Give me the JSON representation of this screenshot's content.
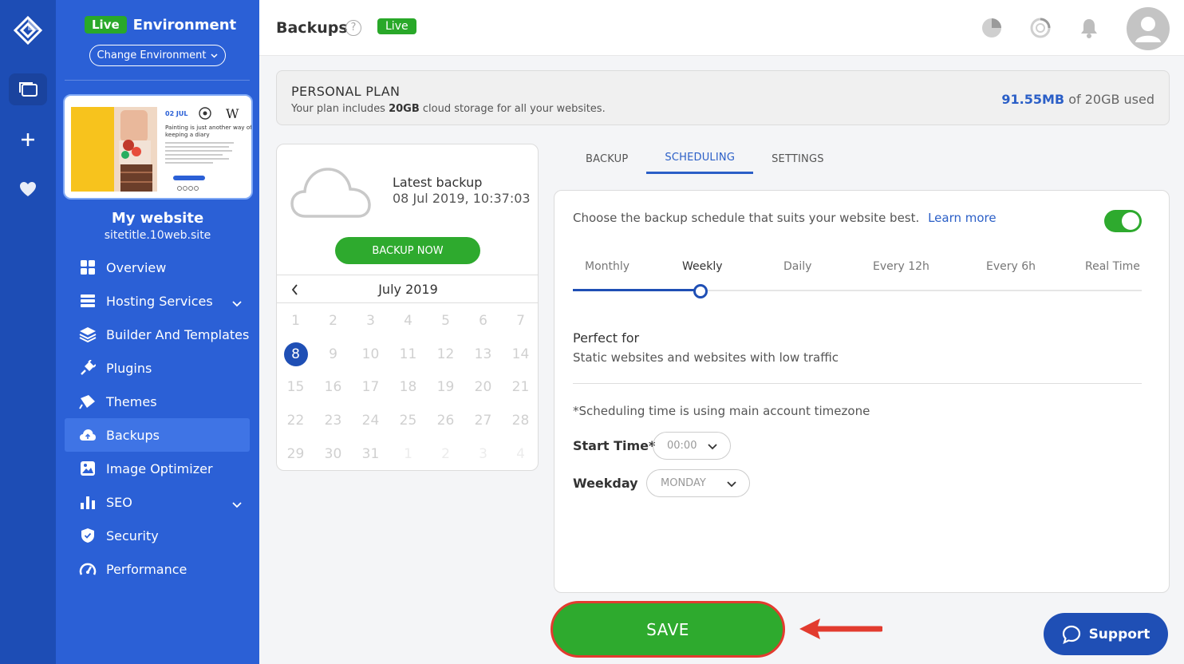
{
  "sidebar": {
    "env_badge": "Live",
    "env_title": "Environment",
    "change_env": "Change Environment",
    "site_name": "My website",
    "site_url": "sitetitle.10web.site",
    "thumb": {
      "date": "02 JUL",
      "headline_1": "Painting is just another way of",
      "headline_2": "keeping a diary"
    },
    "nav": [
      {
        "label": "Overview",
        "icon": "grid-icon"
      },
      {
        "label": "Hosting Services",
        "icon": "server-icon",
        "expandable": true
      },
      {
        "label": "Builder And Templates",
        "icon": "layers-icon"
      },
      {
        "label": "Plugins",
        "icon": "plug-icon"
      },
      {
        "label": "Themes",
        "icon": "brush-icon"
      },
      {
        "label": "Backups",
        "icon": "cloud-icon",
        "active": true
      },
      {
        "label": "Image Optimizer",
        "icon": "image-icon"
      },
      {
        "label": "SEO",
        "icon": "bar-chart-icon",
        "expandable": true
      },
      {
        "label": "Security",
        "icon": "shield-icon"
      },
      {
        "label": "Performance",
        "icon": "gauge-icon"
      }
    ]
  },
  "topbar": {
    "title": "Backups",
    "help": "?",
    "live_badge": "Live"
  },
  "plan": {
    "title": "PERSONAL PLAN",
    "sub_prefix": "Your plan includes ",
    "sub_amount": "20GB",
    "sub_suffix": " cloud storage for all your websites.",
    "used_amount": "91.55MB",
    "used_suffix": " of 20GB used"
  },
  "calendar": {
    "latest_label": "Latest backup",
    "latest_date": "08 Jul 2019, 10:37:03",
    "backup_now": "BACKUP NOW",
    "month": "July 2019",
    "weeks": [
      [
        "1",
        "2",
        "3",
        "4",
        "5",
        "6",
        "7"
      ],
      [
        "8",
        "9",
        "10",
        "11",
        "12",
        "13",
        "14"
      ],
      [
        "15",
        "16",
        "17",
        "18",
        "19",
        "20",
        "21"
      ],
      [
        "22",
        "23",
        "24",
        "25",
        "26",
        "27",
        "28"
      ],
      [
        "29",
        "30",
        "31",
        "1",
        "2",
        "3",
        "4"
      ]
    ],
    "selected": "8"
  },
  "tabs": [
    "BACKUP",
    "SCHEDULING",
    "SETTINGS"
  ],
  "active_tab": "SCHEDULING",
  "scheduling": {
    "description": "Choose the backup schedule that suits your website best.",
    "learn_more": "Learn more",
    "enabled": true,
    "frequencies": [
      "Monthly",
      "Weekly",
      "Daily",
      "Every 12h",
      "Every 6h",
      "Real Time"
    ],
    "selected_frequency": "Weekly",
    "perfect_for_title": "Perfect for",
    "perfect_for_desc": "Static websites and websites with low traffic",
    "timezone_note": "*Scheduling time is using main account timezone",
    "start_time_label": "Start Time*",
    "start_time_value": "00:00",
    "weekday_label": "Weekday",
    "weekday_value": "MONDAY"
  },
  "save_label": "SAVE",
  "support_label": "Support",
  "colors": {
    "primary": "#2b60d6",
    "rail": "#1d4db5",
    "green": "#2eaa2e",
    "accent_blue": "#1f4fb5",
    "annotation_red": "#e23b2f"
  }
}
